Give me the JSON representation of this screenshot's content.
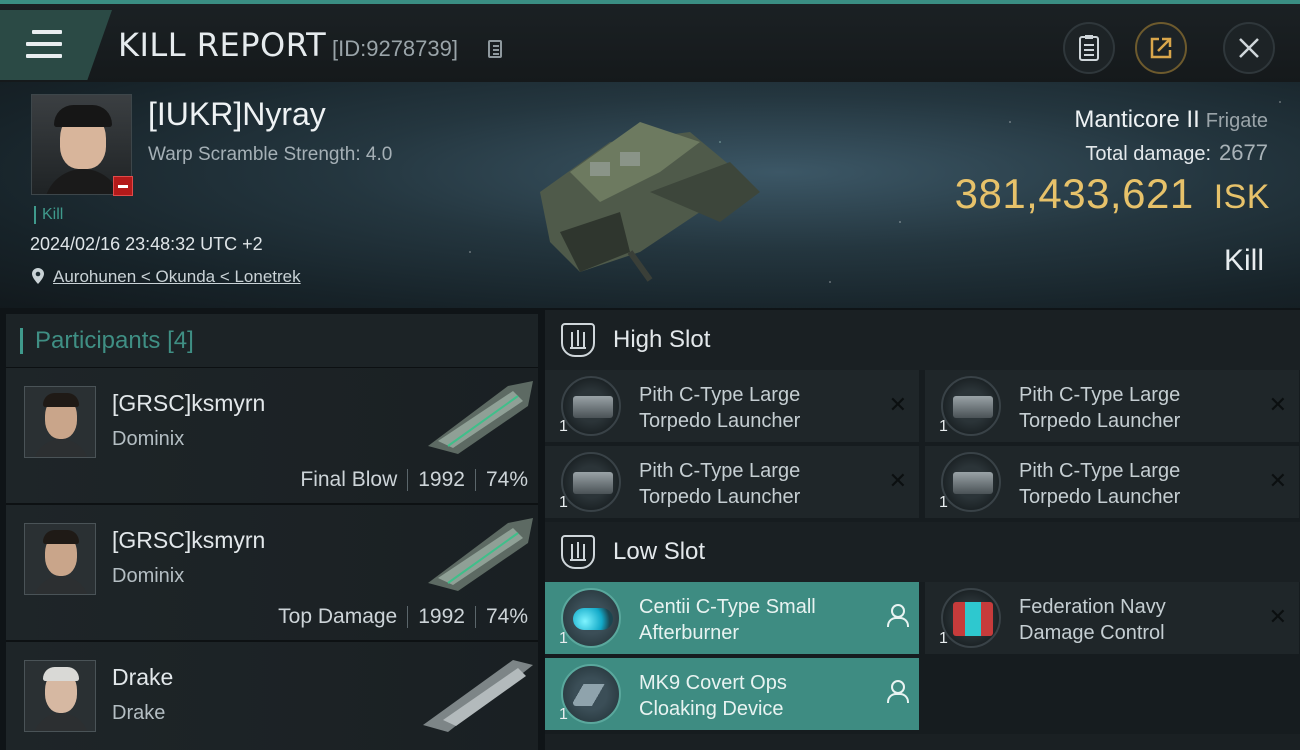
{
  "window": {
    "title": "KILL REPORT",
    "report_id": "[ID:9278739]"
  },
  "victim": {
    "name": "[IUKR]Nyray",
    "warp_scramble": "Warp Scramble Strength: 4.0",
    "tag": "Kill",
    "datetime": "2024/02/16 23:48:32 UTC +2",
    "location": "Aurohunen < Okunda < Lonetrek",
    "ship_name": "Manticore II",
    "ship_class": "Frigate",
    "total_damage_label": "Total damage:",
    "total_damage": "2677",
    "isk_value": "381,433,621",
    "isk_unit": "ISK",
    "result": "Kill"
  },
  "participants": {
    "header": "Participants",
    "count": "[4]",
    "rows": [
      {
        "name": "[GRSC]ksmyrn",
        "ship": "Dominix",
        "role": "Final Blow",
        "damage": "1992",
        "percent": "74%"
      },
      {
        "name": "[GRSC]ksmyrn",
        "ship": "Dominix",
        "role": "Top Damage",
        "damage": "1992",
        "percent": "74%"
      },
      {
        "name": "Drake",
        "ship": "Drake"
      }
    ]
  },
  "fitting": {
    "high_slot": {
      "label": "High Slot",
      "modules": [
        {
          "qty": "1",
          "name": "Pith C-Type Large Torpedo Launcher"
        },
        {
          "qty": "1",
          "name": "Pith C-Type Large Torpedo Launcher"
        },
        {
          "qty": "1",
          "name": "Pith C-Type Large Torpedo Launcher"
        },
        {
          "qty": "1",
          "name": "Pith C-Type Large Torpedo Launcher"
        }
      ]
    },
    "low_slot": {
      "label": "Low Slot",
      "modules": [
        {
          "qty": "1",
          "name": "Centii C-Type Small Afterburner"
        },
        {
          "qty": "1",
          "name": "Federation Navy Damage Control"
        },
        {
          "qty": "1",
          "name": "MK9 Covert Ops Cloaking Device"
        }
      ]
    }
  },
  "colors": {
    "accent_teal": "#3e8c82",
    "isk_gold": "#e7c26a",
    "badge_red": "#b31a1a"
  }
}
